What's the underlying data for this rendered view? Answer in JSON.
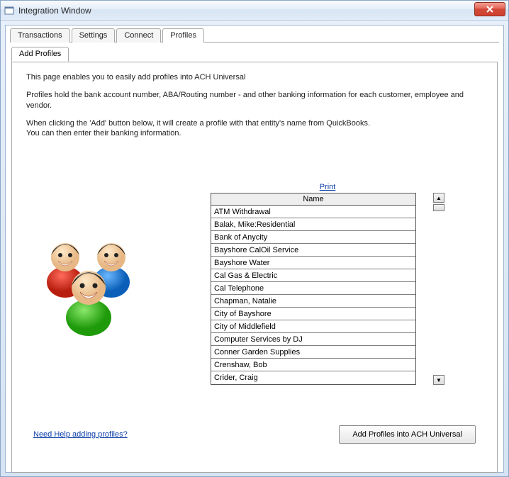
{
  "window": {
    "title": "Integration Window"
  },
  "tabs": {
    "items": [
      "Transactions",
      "Settings",
      "Connect",
      "Profiles"
    ],
    "activeIndex": 3
  },
  "subtab": {
    "label": "Add Profiles"
  },
  "intro": {
    "p1": "This page enables you to easily add profiles into ACH Universal",
    "p2": "Profiles hold the bank account number, ABA/Routing number - and other banking information for each customer, employee and vendor.",
    "p3a": "When clicking the 'Add' button below, it will create a profile with that entity's name from QuickBooks.",
    "p3b": "You can then enter their banking information."
  },
  "list": {
    "print": "Print",
    "header": "Name",
    "rows": [
      "ATM Withdrawal",
      "Balak, Mike:Residential",
      "Bank of Anycity",
      "Bayshore CalOil Service",
      "Bayshore Water",
      "Cal Gas & Electric",
      "Cal Telephone",
      "Chapman, Natalie",
      "City of Bayshore",
      "City of Middlefield",
      "Computer Services by DJ",
      "Conner Garden Supplies",
      "Crenshaw, Bob",
      "Crider, Craig"
    ]
  },
  "actions": {
    "help": "Need Help adding profiles?",
    "addBtn": "Add Profiles into ACH Universal"
  }
}
